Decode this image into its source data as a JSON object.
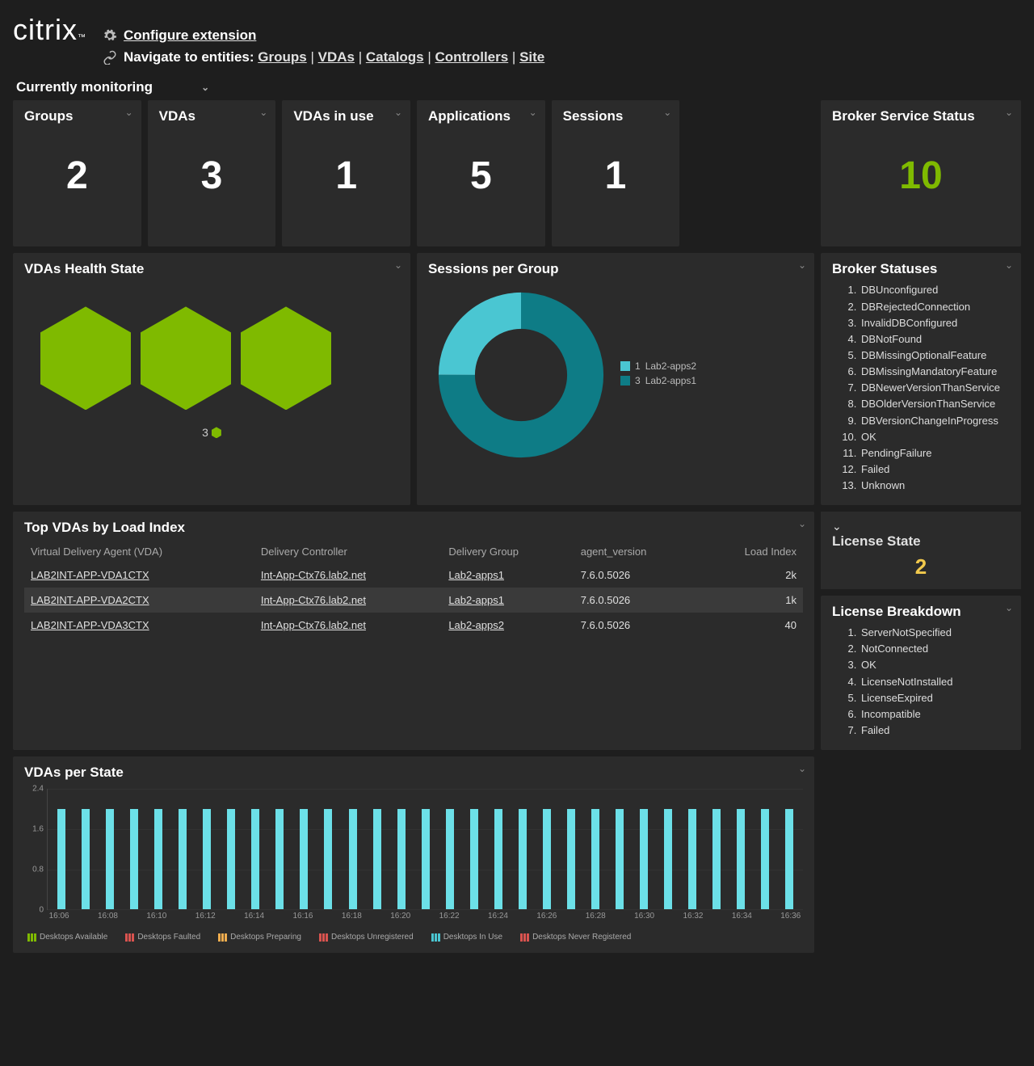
{
  "logo_text": "citrix",
  "links": {
    "configure": "Configure extension",
    "navigate_prefix": "Navigate to entities:",
    "entities": [
      "Groups",
      "VDAs",
      "Catalogs",
      "Controllers",
      "Site"
    ]
  },
  "monitoring_label": "Currently monitoring",
  "kpis": {
    "groups": {
      "label": "Groups",
      "value": "2"
    },
    "vdas": {
      "label": "VDAs",
      "value": "3"
    },
    "vdas_in_use": {
      "label": "VDAs in use",
      "value": "1"
    },
    "applications": {
      "label": "Applications",
      "value": "5"
    },
    "sessions": {
      "label": "Sessions",
      "value": "1"
    },
    "broker": {
      "label": "Broker Service Status",
      "value": "10"
    }
  },
  "health": {
    "title": "VDAs Health State",
    "legend_count": "3"
  },
  "sessions_panel": {
    "title": "Sessions per Group",
    "legend": [
      {
        "count": "1",
        "label": "Lab2-apps2",
        "color": "#4ac6d2"
      },
      {
        "count": "3",
        "label": "Lab2-apps1",
        "color": "#0e7c86"
      }
    ]
  },
  "broker_statuses": {
    "title": "Broker Statuses",
    "items": [
      "DBUnconfigured",
      "DBRejectedConnection",
      "InvalidDBConfigured",
      "DBNotFound",
      "DBMissingOptionalFeature",
      "DBMissingMandatoryFeature",
      "DBNewerVersionThanService",
      "DBOlderVersionThanService",
      "DBVersionChangeInProgress",
      "OK",
      "PendingFailure",
      "Failed",
      "Unknown"
    ]
  },
  "top_vdas": {
    "title": "Top VDAs by Load Index",
    "columns": [
      "Virtual Delivery Agent (VDA)",
      "Delivery Controller",
      "Delivery Group",
      "agent_version",
      "Load Index"
    ],
    "rows": [
      {
        "vda": "LAB2INT-APP-VDA1CTX",
        "ctl": "Int-App-Ctx76.lab2.net",
        "grp": "Lab2-apps1",
        "ver": "7.6.0.5026",
        "li": "2k"
      },
      {
        "vda": "LAB2INT-APP-VDA2CTX",
        "ctl": "Int-App-Ctx76.lab2.net",
        "grp": "Lab2-apps1",
        "ver": "7.6.0.5026",
        "li": "1k"
      },
      {
        "vda": "LAB2INT-APP-VDA3CTX",
        "ctl": "Int-App-Ctx76.lab2.net",
        "grp": "Lab2-apps2",
        "ver": "7.6.0.5026",
        "li": "40"
      }
    ]
  },
  "license_state": {
    "title": "License State",
    "value": "2"
  },
  "license_break": {
    "title": "License Breakdown",
    "items": [
      "ServerNotSpecified",
      "NotConnected",
      "OK",
      "LicenseNotInstalled",
      "LicenseExpired",
      "Incompatible",
      "Failed"
    ]
  },
  "vdas_state": {
    "title": "VDAs per State",
    "legend": [
      {
        "label": "Desktops Available",
        "color": "#7fba00"
      },
      {
        "label": "Desktops Faulted",
        "color": "#d9534f"
      },
      {
        "label": "Desktops Preparing",
        "color": "#f0ad4e"
      },
      {
        "label": "Desktops Unregistered",
        "color": "#d9534f"
      },
      {
        "label": "Desktops In Use",
        "color": "#4ac6d2"
      },
      {
        "label": "Desktops Never Registered",
        "color": "#d9534f"
      }
    ]
  },
  "chart_data": [
    {
      "type": "pie",
      "title": "Sessions per Group",
      "series": [
        {
          "name": "Lab2-apps2",
          "value": 1,
          "color": "#4ac6d2"
        },
        {
          "name": "Lab2-apps1",
          "value": 3,
          "color": "#0e7c86"
        }
      ]
    },
    {
      "type": "bar",
      "title": "VDAs per State",
      "ylabel": "",
      "ylim": [
        0,
        2.4
      ],
      "yticks": [
        0,
        0.8,
        1.6,
        2.4
      ],
      "categories": [
        "16:06",
        "",
        "16:08",
        "",
        "16:10",
        "",
        "16:12",
        "",
        "16:14",
        "",
        "16:16",
        "",
        "16:18",
        "",
        "16:20",
        "",
        "16:22",
        "",
        "16:24",
        "",
        "16:26",
        "",
        "16:28",
        "",
        "16:30",
        "",
        "16:32",
        "",
        "16:34",
        "",
        "16:36"
      ],
      "series": [
        {
          "name": "Desktops Available",
          "color": "#6ce0e8",
          "values": [
            2,
            2,
            2,
            2,
            2,
            2,
            2,
            2,
            2,
            2,
            2,
            2,
            2,
            2,
            2,
            2,
            2,
            2,
            2,
            2,
            2,
            2,
            2,
            2,
            2,
            2,
            2,
            2,
            2,
            2,
            2
          ]
        }
      ]
    }
  ]
}
